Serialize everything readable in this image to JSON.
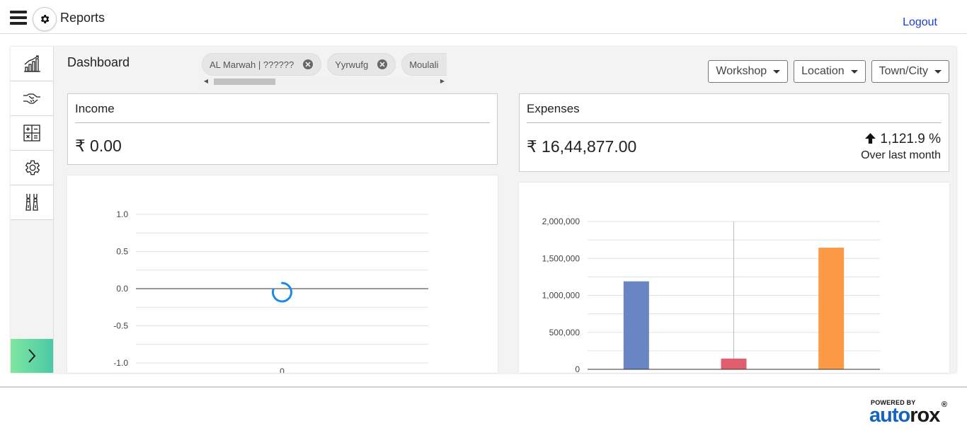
{
  "header": {
    "title": "Reports",
    "logout_label": "Logout"
  },
  "sidebar": {
    "items": [
      {
        "name": "analytics",
        "icon": "line-chart-icon"
      },
      {
        "name": "deals",
        "icon": "handshake-icon"
      },
      {
        "name": "calculator",
        "icon": "calculator-icon"
      },
      {
        "name": "settings",
        "icon": "gear-icon"
      },
      {
        "name": "tools",
        "icon": "tools-icon"
      }
    ],
    "expand_icon": "chevron-right-icon"
  },
  "dashboard": {
    "title": "Dashboard",
    "chips": [
      {
        "label": "AL Marwah | ??????"
      },
      {
        "label": "Yyrwufg"
      },
      {
        "label": "Moulali"
      }
    ],
    "filters": [
      {
        "label": "Workshop"
      },
      {
        "label": "Location"
      },
      {
        "label": "Town/City"
      }
    ]
  },
  "income": {
    "title": "Income",
    "amount": "₹ 0.00"
  },
  "expenses": {
    "title": "Expenses",
    "amount": "₹ 16,44,877.00",
    "trend_value": "1,121.9 %",
    "trend_caption": "Over last month"
  },
  "chart_data": [
    {
      "type": "line",
      "yticks": [
        "1.0",
        "0.5",
        "0.0",
        "-0.5",
        "-1.0"
      ],
      "ylim": [
        -1.0,
        1.0
      ],
      "x": [
        "0"
      ],
      "series": [],
      "loading": true
    },
    {
      "type": "bar",
      "yticks": [
        "2,000,000",
        "1,500,000",
        "1,000,000",
        "500,000",
        "0"
      ],
      "ylim": [
        0,
        2000000
      ],
      "categories": [
        "",
        "",
        ""
      ],
      "values": [
        1190000,
        145000,
        1645000
      ],
      "colors": [
        "#6a85c4",
        "#e15e6f",
        "#fd9a45"
      ]
    }
  ],
  "brand": {
    "powered_by": "POWERED BY",
    "name_a": "auto",
    "name_b": "rox",
    "reg": "®"
  },
  "colors": {
    "accent": "#1f3bd6",
    "spinner": "#1e88e5"
  }
}
